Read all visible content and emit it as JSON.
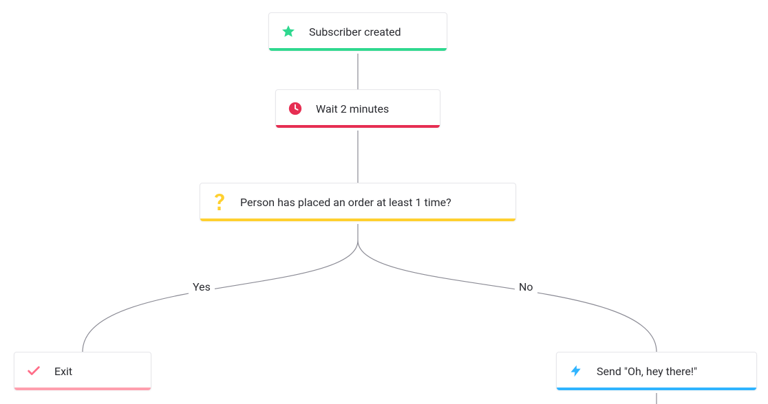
{
  "nodes": {
    "trigger": {
      "label": "Subscriber created",
      "icon": "star-icon",
      "accent": "#2fd88f"
    },
    "wait": {
      "label": "Wait 2 minutes",
      "icon": "clock-icon",
      "accent": "#e62e52"
    },
    "condition": {
      "label": "Person has placed an order at least 1 time?",
      "icon": "question-icon",
      "accent": "#ffd02f"
    },
    "exit": {
      "label": "Exit",
      "icon": "check-icon",
      "accent": "#ff9fae"
    },
    "send": {
      "label": "Send \"Oh, hey there!\"",
      "icon": "lightning-icon",
      "accent": "#2fb4ff"
    }
  },
  "branches": {
    "yes_label": "Yes",
    "no_label": "No"
  }
}
